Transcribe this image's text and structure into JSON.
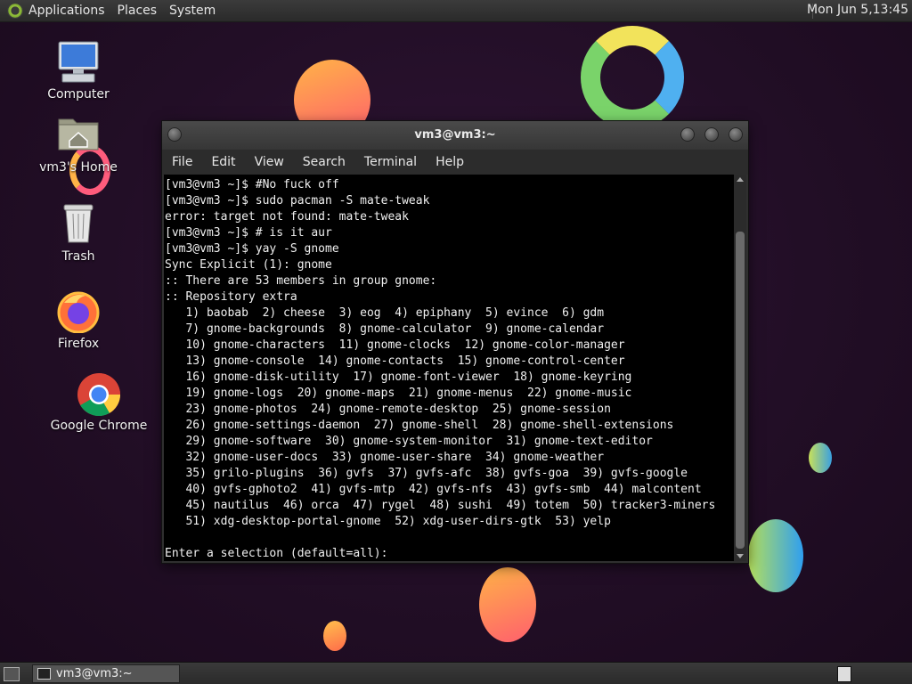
{
  "top_panel": {
    "menus": [
      "Applications",
      "Places",
      "System"
    ],
    "clock": "Mon Jun  5,13:45"
  },
  "desktop_icons": [
    {
      "label": "Computer",
      "icon": "computer-icon"
    },
    {
      "label": "vm3's Home",
      "icon": "home-folder-icon"
    },
    {
      "label": "Trash",
      "icon": "trash-icon"
    },
    {
      "label": "Firefox",
      "icon": "firefox-icon"
    },
    {
      "label": "Google Chrome",
      "icon": "chrome-icon"
    }
  ],
  "window": {
    "title": "vm3@vm3:~",
    "menus": [
      "File",
      "Edit",
      "View",
      "Search",
      "Terminal",
      "Help"
    ]
  },
  "terminal": {
    "lines": [
      "[vm3@vm3 ~]$ #No fuck off",
      "[vm3@vm3 ~]$ sudo pacman -S mate-tweak",
      "error: target not found: mate-tweak",
      "[vm3@vm3 ~]$ # is it aur",
      "[vm3@vm3 ~]$ yay -S gnome",
      "Sync Explicit (1): gnome",
      ":: There are 53 members in group gnome:",
      ":: Repository extra",
      "   1) baobab  2) cheese  3) eog  4) epiphany  5) evince  6) gdm",
      "   7) gnome-backgrounds  8) gnome-calculator  9) gnome-calendar",
      "   10) gnome-characters  11) gnome-clocks  12) gnome-color-manager",
      "   13) gnome-console  14) gnome-contacts  15) gnome-control-center",
      "   16) gnome-disk-utility  17) gnome-font-viewer  18) gnome-keyring",
      "   19) gnome-logs  20) gnome-maps  21) gnome-menus  22) gnome-music",
      "   23) gnome-photos  24) gnome-remote-desktop  25) gnome-session",
      "   26) gnome-settings-daemon  27) gnome-shell  28) gnome-shell-extensions",
      "   29) gnome-software  30) gnome-system-monitor  31) gnome-text-editor",
      "   32) gnome-user-docs  33) gnome-user-share  34) gnome-weather",
      "   35) grilo-plugins  36) gvfs  37) gvfs-afc  38) gvfs-goa  39) gvfs-google",
      "   40) gvfs-gphoto2  41) gvfs-mtp  42) gvfs-nfs  43) gvfs-smb  44) malcontent",
      "   45) nautilus  46) orca  47) rygel  48) sushi  49) totem  50) tracker3-miners",
      "   51) xdg-desktop-portal-gnome  52) xdg-user-dirs-gtk  53) yelp",
      "",
      "Enter a selection (default=all):"
    ]
  },
  "taskbar": {
    "task_label": "vm3@vm3:~"
  }
}
